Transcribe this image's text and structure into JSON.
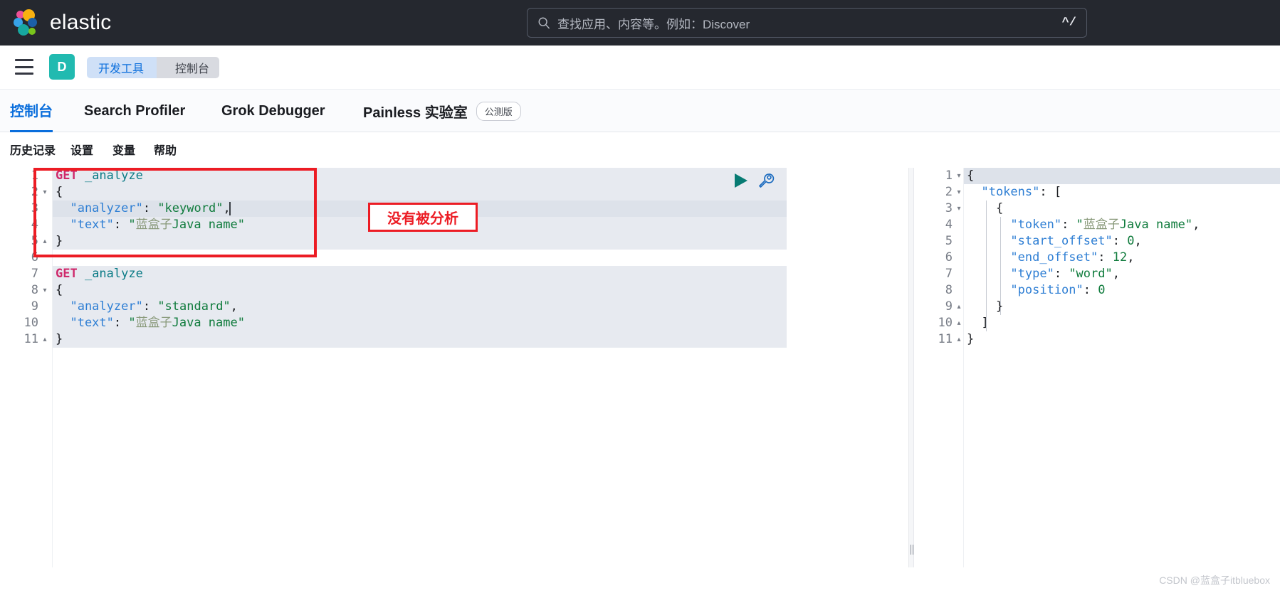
{
  "header": {
    "brand": "elastic",
    "search": {
      "placeholder": "查找应用、内容等。例如：Discover",
      "shortcut": "^/",
      "icon": "search-icon"
    }
  },
  "breadcrumb": {
    "items": [
      "开发工具",
      "控制台"
    ],
    "app_initial": "D"
  },
  "tabs": [
    {
      "label": "控制台",
      "active": true,
      "badge": ""
    },
    {
      "label": "Search Profiler",
      "active": false,
      "badge": ""
    },
    {
      "label": "Grok Debugger",
      "active": false,
      "badge": ""
    },
    {
      "label": "Painless 实验室",
      "active": false,
      "badge": "公测版"
    }
  ],
  "console_menu": [
    "历史记录",
    "设置",
    "变量",
    "帮助"
  ],
  "actions": {
    "play": "play-icon",
    "wrench": "wrench-icon"
  },
  "request": {
    "lines": [
      {
        "n": "1",
        "fold": "",
        "text": "GET _analyze"
      },
      {
        "n": "2",
        "fold": "▾",
        "text": "{"
      },
      {
        "n": "3",
        "fold": "",
        "text": "  \"analyzer\": \"keyword\","
      },
      {
        "n": "4",
        "fold": "",
        "text": "  \"text\": \"蓝盒子Java name\""
      },
      {
        "n": "5",
        "fold": "▴",
        "text": "}"
      },
      {
        "n": "6",
        "fold": "",
        "text": ""
      },
      {
        "n": "7",
        "fold": "",
        "text": "GET _analyze"
      },
      {
        "n": "8",
        "fold": "▾",
        "text": "{"
      },
      {
        "n": "9",
        "fold": "",
        "text": "  \"analyzer\": \"standard\","
      },
      {
        "n": "10",
        "fold": "",
        "text": "  \"text\": \"蓝盒子Java name\""
      },
      {
        "n": "11",
        "fold": "▴",
        "text": "}"
      }
    ]
  },
  "response": {
    "lines": [
      {
        "n": "1",
        "fold": "▾",
        "text": "{"
      },
      {
        "n": "2",
        "fold": "▾",
        "text": "  \"tokens\": ["
      },
      {
        "n": "3",
        "fold": "▾",
        "text": "    {"
      },
      {
        "n": "4",
        "fold": "",
        "text": "      \"token\": \"蓝盒子Java name\","
      },
      {
        "n": "5",
        "fold": "",
        "text": "      \"start_offset\": 0,"
      },
      {
        "n": "6",
        "fold": "",
        "text": "      \"end_offset\": 12,"
      },
      {
        "n": "7",
        "fold": "",
        "text": "      \"type\": \"word\","
      },
      {
        "n": "8",
        "fold": "",
        "text": "      \"position\": 0"
      },
      {
        "n": "9",
        "fold": "▴",
        "text": "    }"
      },
      {
        "n": "10",
        "fold": "▴",
        "text": "  ]"
      },
      {
        "n": "11",
        "fold": "▴",
        "text": "}"
      }
    ]
  },
  "annotations": {
    "callout_label": "没有被分析",
    "color": "#ec1c24"
  },
  "watermark": "CSDN @蓝盒子itbluebox"
}
